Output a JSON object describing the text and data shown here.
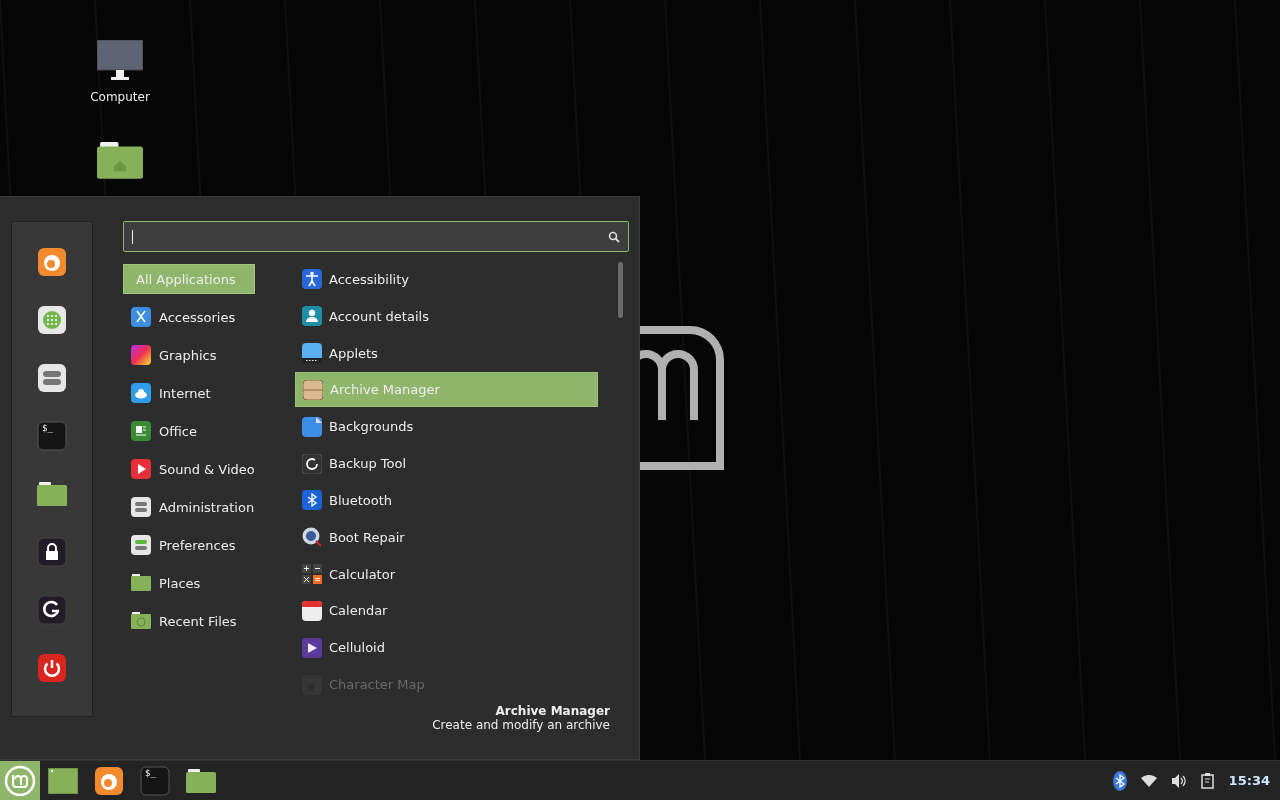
{
  "desktop": {
    "icons": [
      {
        "kind": "computer",
        "label": "Computer"
      },
      {
        "kind": "home-folder"
      }
    ]
  },
  "menu": {
    "search": {
      "focused": true
    },
    "favorites": [
      {
        "kind": "browser"
      },
      {
        "kind": "software"
      },
      {
        "kind": "settings"
      },
      {
        "kind": "terminal",
        "glyph": "$_"
      },
      {
        "kind": "folder"
      },
      {
        "kind": "lock"
      },
      {
        "kind": "logout"
      },
      {
        "kind": "power"
      }
    ],
    "categories": [
      {
        "label": "All Applications",
        "selected": true
      },
      {
        "label": "Accessories",
        "selected": false
      },
      {
        "label": "Graphics",
        "selected": false
      },
      {
        "label": "Internet",
        "selected": false
      },
      {
        "label": "Office",
        "selected": false
      },
      {
        "label": "Sound & Video",
        "selected": false
      },
      {
        "label": "Administration",
        "selected": false
      },
      {
        "label": "Preferences",
        "selected": false
      },
      {
        "label": "Places",
        "selected": false
      },
      {
        "label": "Recent Files",
        "selected": false
      }
    ],
    "applications": [
      {
        "label": "Accessibility",
        "selected": false,
        "faded": false
      },
      {
        "label": "Account details",
        "selected": false,
        "faded": false
      },
      {
        "label": "Applets",
        "selected": false,
        "faded": false
      },
      {
        "label": "Archive Manager",
        "selected": true,
        "faded": false
      },
      {
        "label": "Backgrounds",
        "selected": false,
        "faded": false
      },
      {
        "label": "Backup Tool",
        "selected": false,
        "faded": false
      },
      {
        "label": "Bluetooth",
        "selected": false,
        "faded": false
      },
      {
        "label": "Boot Repair",
        "selected": false,
        "faded": false
      },
      {
        "label": "Calculator",
        "selected": false,
        "faded": false
      },
      {
        "label": "Calendar",
        "selected": false,
        "faded": false
      },
      {
        "label": "Celluloid",
        "selected": false,
        "faded": false
      },
      {
        "label": "Character Map",
        "selected": false,
        "faded": true
      }
    ],
    "description": {
      "title": "Archive Manager",
      "text": "Create and modify an archive"
    }
  },
  "taskbar": {
    "windows": [
      {
        "kind": "window"
      },
      {
        "kind": "browser"
      },
      {
        "kind": "terminal",
        "glyph": "$_"
      },
      {
        "kind": "folder"
      }
    ],
    "tray": [
      {
        "kind": "bluetooth"
      },
      {
        "kind": "wifi"
      },
      {
        "kind": "volume"
      },
      {
        "kind": "clipboard"
      }
    ],
    "clock": "15:34"
  }
}
